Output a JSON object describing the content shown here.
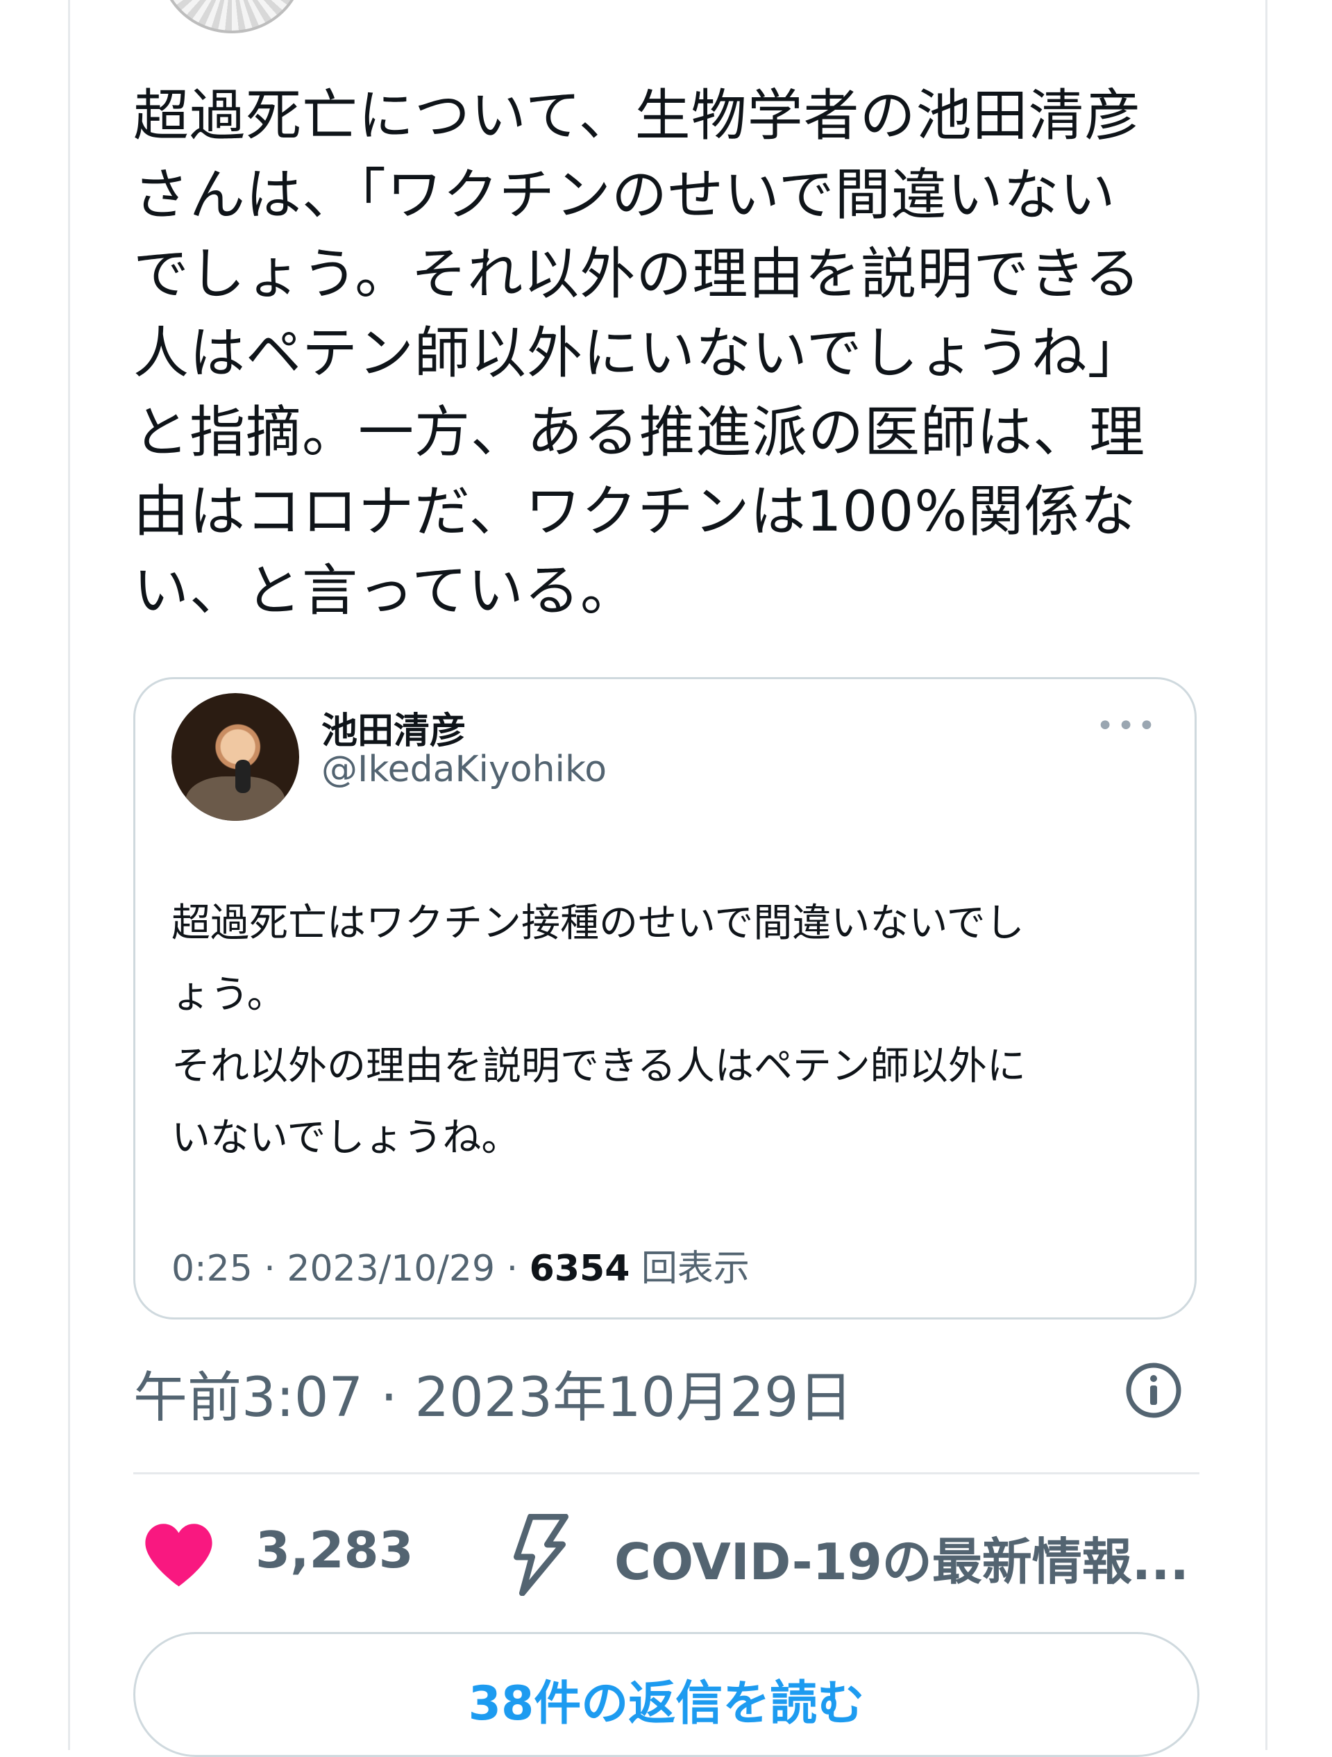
{
  "tweet": {
    "text": "超過死亡について、生物学者の池田清彦\nさんは、「ワクチンのせいで間違いない\nでしょう。それ以外の理由を説明できる\n人はペテン師以外にいないでしょうね」\nと指摘。一方、ある推進派の医師は、理\n由はコロナだ、ワクチンは100%関係な\nい、と言っている。",
    "timestamp": "午前3:07 · 2023年10月29日",
    "likes": "3,283",
    "topic": "COVID-19の最新情報...",
    "replies_button": "38件の返信を読む"
  },
  "quoted_tweet": {
    "name": "池田清彦",
    "handle": "@IkedaKiyohiko",
    "more_label": "•••",
    "text": "超過死亡はワクチン接種のせいで間違いないでし\nょう。\nそれ以外の理由を説明できる人はペテン師以外に\nいないでしょうね。",
    "time": "0:25 · 2023/10/29 · ",
    "views": "6354",
    "views_label": " 回表示"
  },
  "icons": {
    "like": "heart-icon",
    "topic": "lightning-icon",
    "info": "info-icon",
    "more": "more-icon"
  },
  "colors": {
    "like": "#f91880",
    "secondary_text": "#536471",
    "link": "#1d9bf0",
    "border": "#cfd9de"
  }
}
